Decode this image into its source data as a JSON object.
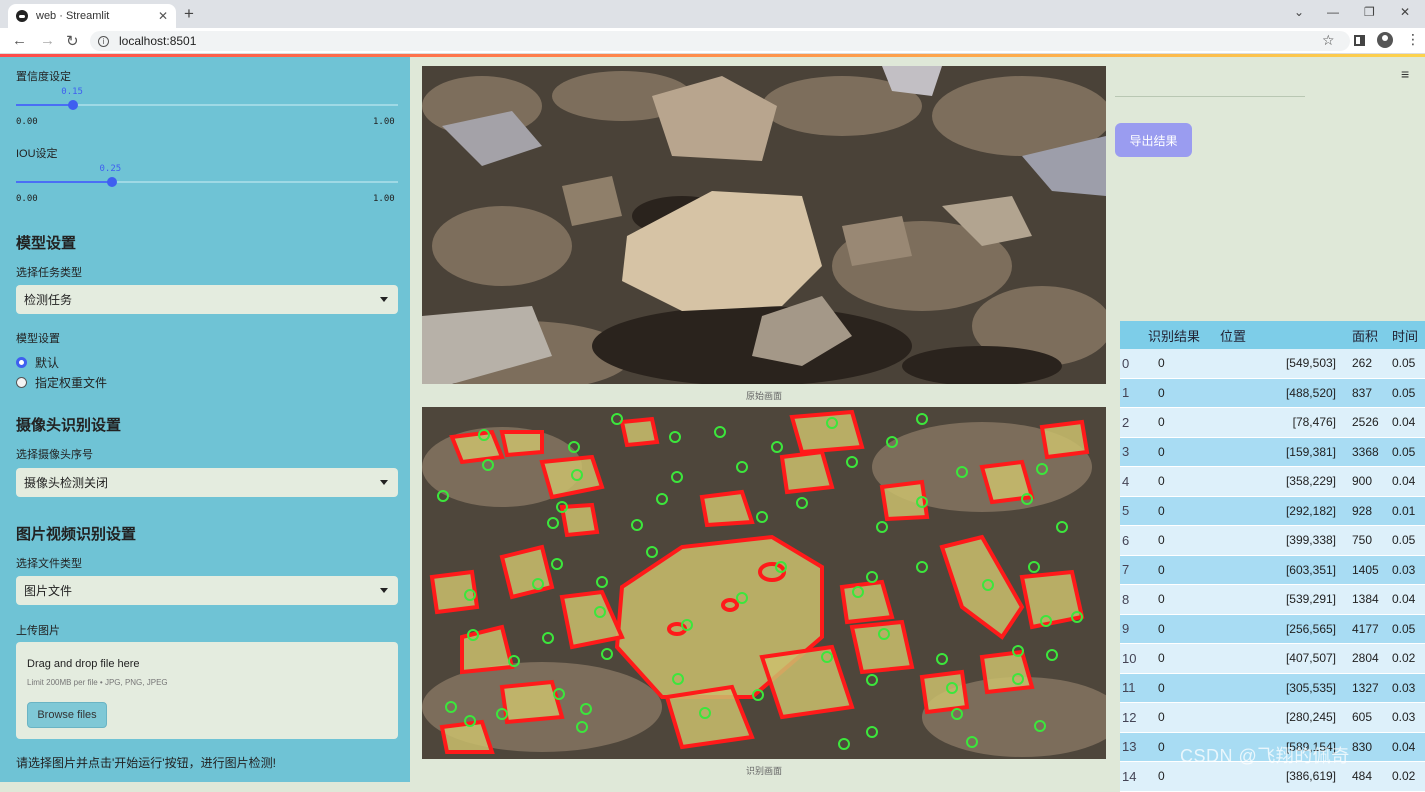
{
  "browser": {
    "tab_title": "web · Streamlit",
    "tab_close": "✕",
    "new_tab": "+",
    "url": "localhost:8501",
    "win_min": "⌄",
    "win_minimize": "—",
    "win_restore": "❐",
    "win_close": "✕"
  },
  "sidebar": {
    "conf_label": "置信度设定",
    "conf_value": "0.15",
    "conf_fraction": 0.15,
    "conf_min": "0.00",
    "conf_max": "1.00",
    "iou_label": "IOU设定",
    "iou_value": "0.25",
    "iou_fraction": 0.25,
    "iou_min": "0.00",
    "iou_max": "1.00",
    "model_heading": "模型设置",
    "task_label": "选择任务类型",
    "task_value": "检测任务",
    "model_label": "模型设置",
    "radio_default": "默认",
    "radio_custom": "指定权重文件",
    "camera_heading": "摄像头识别设置",
    "camera_label": "选择摄像头序号",
    "camera_value": "摄像头检测关闭",
    "media_heading": "图片视频识别设置",
    "filetype_label": "选择文件类型",
    "filetype_value": "图片文件",
    "upload_label": "上传图片",
    "drag_text": "Drag and drop file here",
    "limit_text": "Limit 200MB per file • JPG, PNG, JPEG",
    "browse_label": "Browse files",
    "hint": "请选择图片并点击'开始运行'按钮，进行图片检测!"
  },
  "main": {
    "original_caption": "原始画面",
    "detected_caption": "识别画面"
  },
  "right": {
    "export_label": "导出结果",
    "menu_icon": "≡",
    "watermark": "CSDN @飞翔的佩奇"
  },
  "table": {
    "headers": [
      "识别结果",
      "位置",
      "面积",
      "时间"
    ],
    "rows": [
      {
        "idx": "0",
        "result": "0",
        "pos": "[549,503]",
        "area": "262",
        "time": "0.05"
      },
      {
        "idx": "1",
        "result": "0",
        "pos": "[488,520]",
        "area": "837",
        "time": "0.05"
      },
      {
        "idx": "2",
        "result": "0",
        "pos": "[78,476]",
        "area": "2526",
        "time": "0.04"
      },
      {
        "idx": "3",
        "result": "0",
        "pos": "[159,381]",
        "area": "3368",
        "time": "0.05"
      },
      {
        "idx": "4",
        "result": "0",
        "pos": "[358,229]",
        "area": "900",
        "time": "0.04"
      },
      {
        "idx": "5",
        "result": "0",
        "pos": "[292,182]",
        "area": "928",
        "time": "0.01"
      },
      {
        "idx": "6",
        "result": "0",
        "pos": "[399,338]",
        "area": "750",
        "time": "0.05"
      },
      {
        "idx": "7",
        "result": "0",
        "pos": "[603,351]",
        "area": "1405",
        "time": "0.03"
      },
      {
        "idx": "8",
        "result": "0",
        "pos": "[539,291]",
        "area": "1384",
        "time": "0.04"
      },
      {
        "idx": "9",
        "result": "0",
        "pos": "[256,565]",
        "area": "4177",
        "time": "0.05"
      },
      {
        "idx": "10",
        "result": "0",
        "pos": "[407,507]",
        "area": "2804",
        "time": "0.02"
      },
      {
        "idx": "11",
        "result": "0",
        "pos": "[305,535]",
        "area": "1327",
        "time": "0.03"
      },
      {
        "idx": "12",
        "result": "0",
        "pos": "[280,245]",
        "area": "605",
        "time": "0.03"
      },
      {
        "idx": "13",
        "result": "0",
        "pos": "[589,154]",
        "area": "830",
        "time": "0.04"
      },
      {
        "idx": "14",
        "result": "0",
        "pos": "[386,619]",
        "area": "484",
        "time": "0.02"
      }
    ]
  }
}
